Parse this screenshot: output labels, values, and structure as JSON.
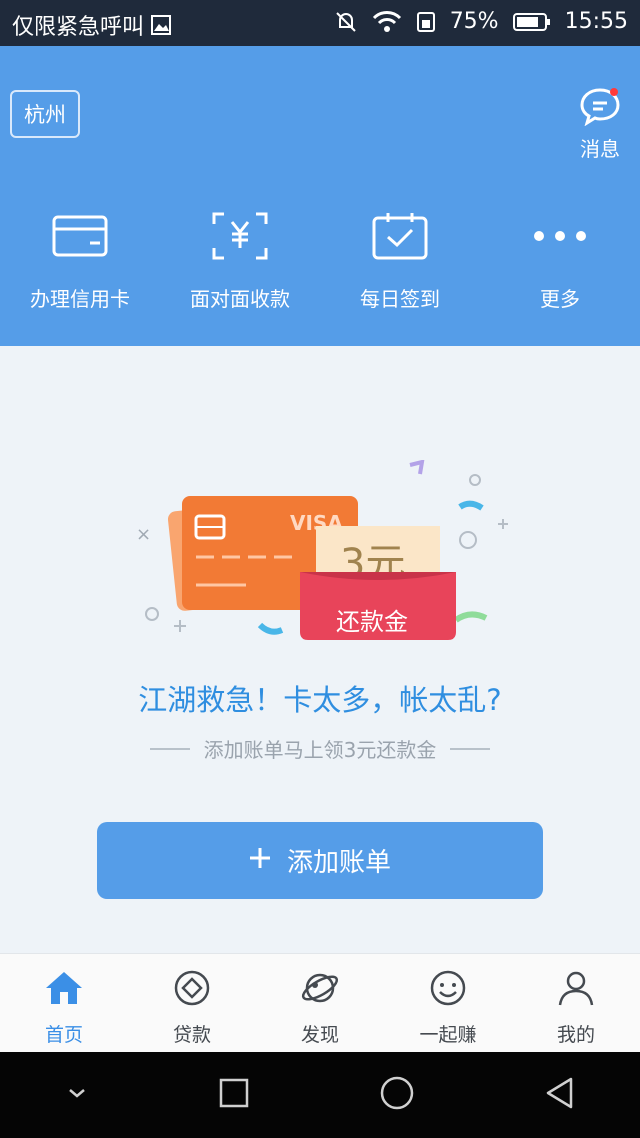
{
  "status_bar": {
    "carrier_text": "仅限紧急呼叫",
    "battery": "75%",
    "time": "15:55"
  },
  "header": {
    "city": "杭州",
    "message_label": "消息",
    "quick_actions": [
      {
        "label": "办理信用卡",
        "icon": "credit-card-icon"
      },
      {
        "label": "面对面收款",
        "icon": "scan-yen-icon"
      },
      {
        "label": "每日签到",
        "icon": "calendar-check-icon"
      },
      {
        "label": "更多",
        "icon": "more-dots-icon"
      }
    ]
  },
  "promo": {
    "card_brand": "VISA",
    "coupon_amount": "3元",
    "coupon_label": "还款金",
    "headline": "江湖救急！卡太多，帐太乱?",
    "subline": "添加账单马上领3元还款金",
    "button_label": "添加账单"
  },
  "tabbar": {
    "tabs": [
      {
        "label": "首页",
        "icon": "home-icon",
        "active": true
      },
      {
        "label": "贷款",
        "icon": "loan-icon",
        "active": false
      },
      {
        "label": "发现",
        "icon": "planet-icon",
        "active": false
      },
      {
        "label": "一起赚",
        "icon": "smile-icon",
        "active": false
      },
      {
        "label": "我的",
        "icon": "user-icon",
        "active": false
      }
    ]
  },
  "colors": {
    "brand_blue": "#559de8",
    "status_bar": "#1f2a3b",
    "card_orange": "#f27a35",
    "coupon_red": "#e8445a"
  }
}
